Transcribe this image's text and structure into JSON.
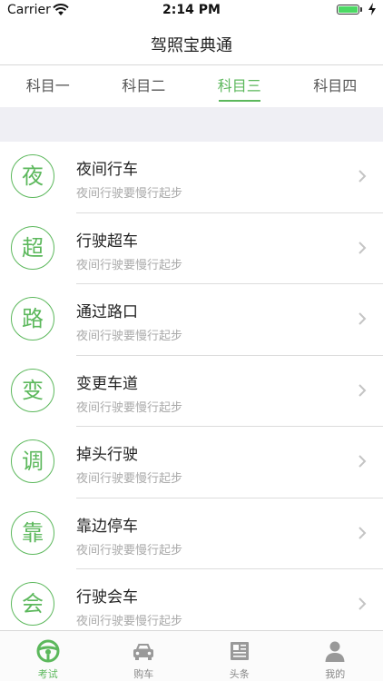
{
  "status_bar": {
    "carrier": "Carrier",
    "time": "2:14 PM",
    "battery_level": 1.0
  },
  "nav": {
    "title": "驾照宝典通"
  },
  "tabs": [
    {
      "label": "科目一",
      "active": false
    },
    {
      "label": "科目二",
      "active": false
    },
    {
      "label": "科目三",
      "active": true
    },
    {
      "label": "科目四",
      "active": false
    }
  ],
  "list": [
    {
      "badge": "夜",
      "title": "夜间行车",
      "subtitle": "夜间行驶要慢行起步"
    },
    {
      "badge": "超",
      "title": "行驶超车",
      "subtitle": "夜间行驶要慢行起步"
    },
    {
      "badge": "路",
      "title": "通过路口",
      "subtitle": "夜间行驶要慢行起步"
    },
    {
      "badge": "变",
      "title": "变更车道",
      "subtitle": "夜间行驶要慢行起步"
    },
    {
      "badge": "调",
      "title": "掉头行驶",
      "subtitle": "夜间行驶要慢行起步"
    },
    {
      "badge": "靠",
      "title": "靠边停车",
      "subtitle": "夜间行驶要慢行起步"
    },
    {
      "badge": "会",
      "title": "行驶会车",
      "subtitle": "夜间行驶要慢行起步"
    }
  ],
  "tab_bar": [
    {
      "label": "考试",
      "icon": "steering-wheel-icon",
      "active": true
    },
    {
      "label": "购车",
      "icon": "car-icon",
      "active": false
    },
    {
      "label": "头条",
      "icon": "newspaper-icon",
      "active": false
    },
    {
      "label": "我的",
      "icon": "person-icon",
      "active": false
    }
  ],
  "colors": {
    "accent": "#5cb85c",
    "separator": "#dcdcdc",
    "section_bg": "#efeff4",
    "subtitle": "#aaaaaa"
  }
}
